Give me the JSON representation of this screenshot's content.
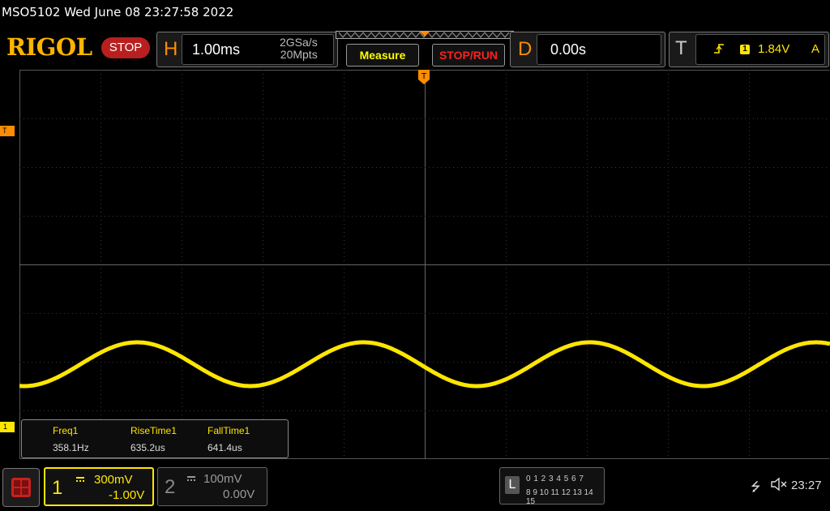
{
  "title_bar": {
    "text": "MSO5102  Wed June 08 23:27:58 2022"
  },
  "toolbar": {
    "logo": "RIGOL",
    "run_state": "STOP",
    "horizontal": {
      "letter": "H",
      "timebase": "1.00ms",
      "sample_rate": "2GSa/s",
      "memory_depth": "20Mpts"
    },
    "measure_label": "Measure",
    "stop_run_label": "STOP/RUN",
    "delay": {
      "letter": "D",
      "value": "0.00s"
    },
    "trigger": {
      "letter": "T",
      "edge_icon": "rising-edge-icon",
      "source": "1",
      "level": "1.84V",
      "mode": "A"
    }
  },
  "markers": {
    "trigger_position": "T",
    "trigger_level": "T",
    "ch1_offset": "1"
  },
  "measurements": [
    {
      "label": "Freq1",
      "value": "358.1Hz"
    },
    {
      "label": "RiseTime1",
      "value": "635.2us"
    },
    {
      "label": "FallTime1",
      "value": "641.4us"
    }
  ],
  "channels": [
    {
      "number": "1",
      "scale": "300mV",
      "offset": "-1.00V",
      "active": true,
      "color": "#ffe600"
    },
    {
      "number": "2",
      "scale": "100mV",
      "offset": "0.00V",
      "active": false,
      "color": "#888888"
    }
  ],
  "logic": {
    "letter": "L",
    "row1": "0 1 2 3   4 5 6 7",
    "row2": "8  9 10 11  12 13 14 15"
  },
  "status": {
    "usb_icon": "usb-icon",
    "speaker_icon": "speaker-muted-icon",
    "time": "23:27"
  },
  "waveform": {
    "color": "#ffe600",
    "frequency_hz": 358.1,
    "time_per_div_ms": 1.0,
    "horizontal_divisions": 10,
    "volts_per_div": 0.3,
    "vertical_divisions": 8,
    "dc_level_div_from_center": -2.05,
    "amplitude_div": 0.45,
    "start_phase_cycles": -0.27
  }
}
